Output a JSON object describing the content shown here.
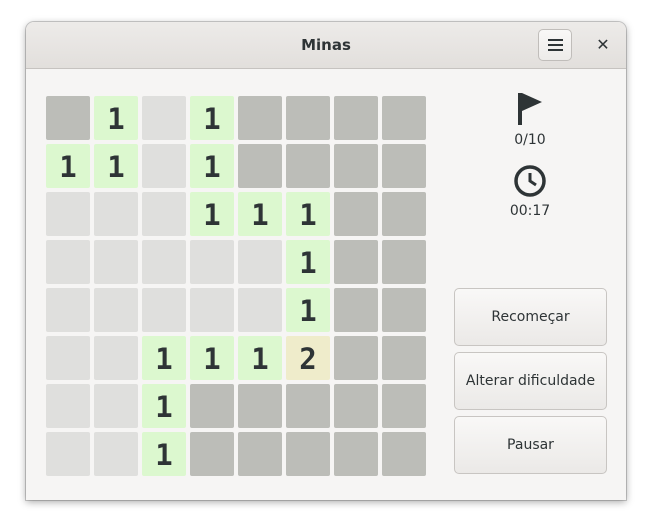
{
  "window": {
    "title": "Minas"
  },
  "stats": {
    "flags": "0/10",
    "time": "00:17"
  },
  "buttons": {
    "restart": "Recomeçar",
    "difficulty": "Alterar dificuldade",
    "pause": "Pausar"
  },
  "board": {
    "rows": 8,
    "cols": 8,
    "cells": [
      [
        "u",
        "1",
        "e",
        "1",
        "u",
        "u",
        "u",
        "u"
      ],
      [
        "1",
        "1",
        "e",
        "1",
        "u",
        "u",
        "u",
        "u"
      ],
      [
        "e",
        "e",
        "e",
        "1",
        "1",
        "1",
        "u",
        "u"
      ],
      [
        "e",
        "e",
        "e",
        "e",
        "e",
        "1",
        "u",
        "u"
      ],
      [
        "e",
        "e",
        "e",
        "e",
        "e",
        "1",
        "u",
        "u"
      ],
      [
        "e",
        "e",
        "1",
        "1",
        "1",
        "2",
        "u",
        "u"
      ],
      [
        "e",
        "e",
        "1",
        "u",
        "u",
        "u",
        "u",
        "u"
      ],
      [
        "e",
        "e",
        "1",
        "u",
        "u",
        "u",
        "u",
        "u"
      ]
    ]
  },
  "colors": {
    "unrevealed": "#bcbdb8",
    "empty": "#dfdfdd",
    "one": "#dcf8cf",
    "two": "#efeccb"
  }
}
